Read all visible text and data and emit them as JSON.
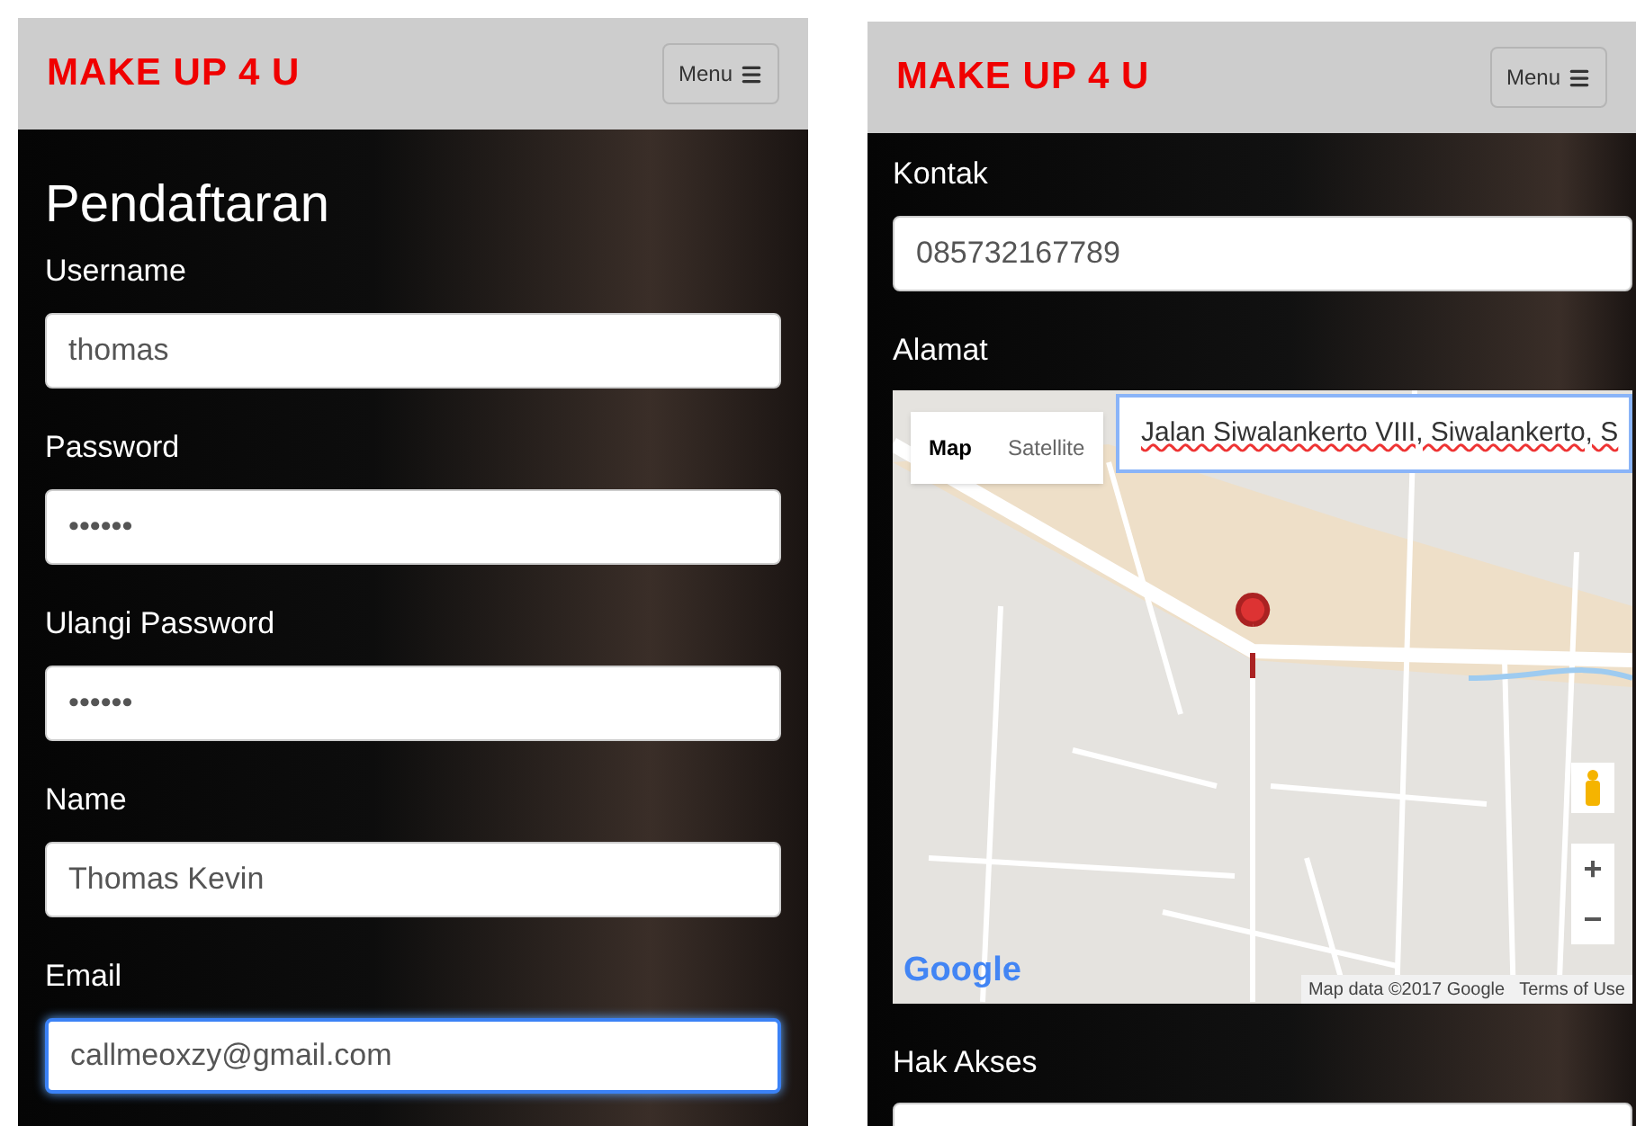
{
  "left_screen": {
    "brand": "MAKE UP 4 U",
    "menu_button": "Menu",
    "heading": "Pendaftaran",
    "fields": [
      {
        "label": "Username",
        "value": "thomas",
        "focused": false
      },
      {
        "label": "Password",
        "value": "••••••",
        "focused": false
      },
      {
        "label": "Ulangi Password",
        "value": "••••••",
        "focused": false
      },
      {
        "label": "Name",
        "value": "Thomas Kevin",
        "focused": false
      },
      {
        "label": "Email",
        "value": "callmeoxzy@gmail.com",
        "focused": true
      }
    ]
  },
  "right_screen": {
    "brand": "MAKE UP 4 U",
    "menu_button": "Menu",
    "contact": {
      "label": "Kontak",
      "value": "085732167789"
    },
    "address": {
      "label": "Alamat",
      "map": {
        "search_value": "Jalan Siwalankerto VIII, Siwalankerto, S",
        "map_types": [
          {
            "label": "Map",
            "selected": true
          },
          {
            "label": "Satellite",
            "selected": false
          }
        ],
        "zoom_in": "+",
        "zoom_out": "−",
        "logo": "Google",
        "attribution": "Map data ©2017 Google",
        "terms": "Terms of Use"
      }
    },
    "access": {
      "label": "Hak Akses"
    }
  }
}
